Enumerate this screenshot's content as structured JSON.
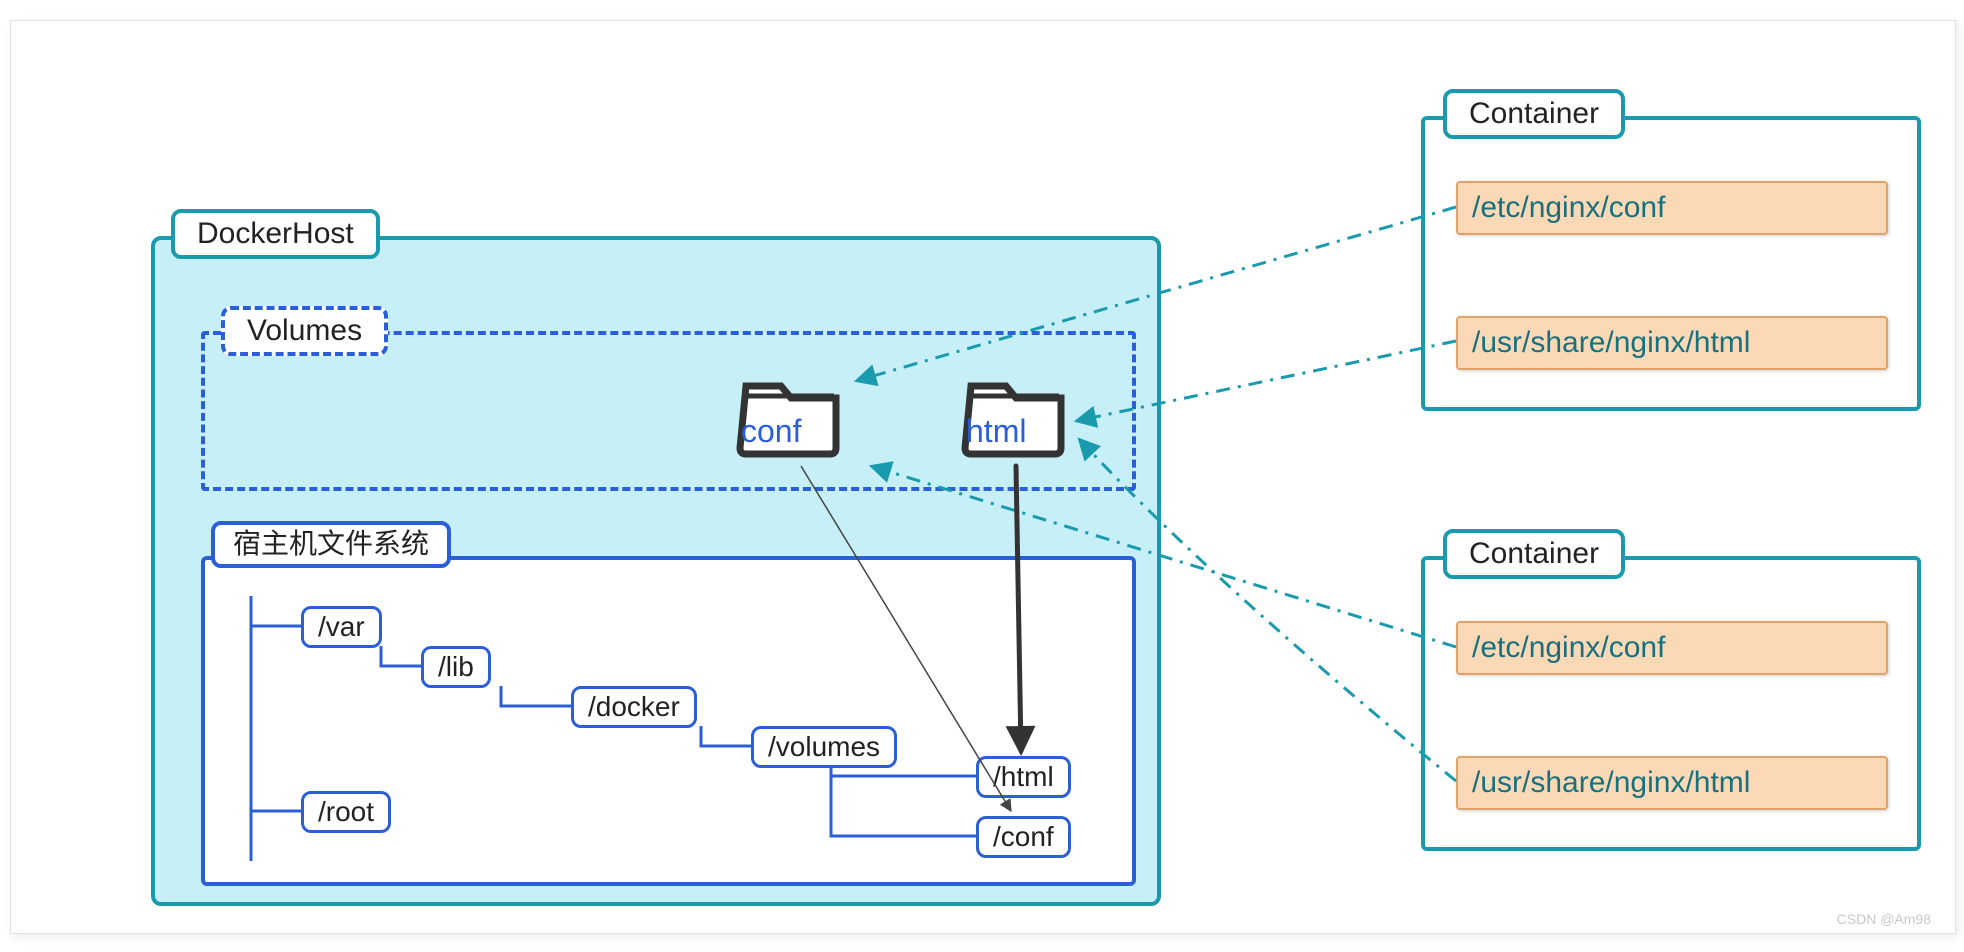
{
  "watermark": "CSDN @Am98",
  "dockerHost": {
    "title": "DockerHost"
  },
  "volumes": {
    "title": "Volumes",
    "folders": {
      "conf": "conf",
      "html": "html"
    }
  },
  "hostFs": {
    "title": "宿主机文件系统",
    "var": "/var",
    "lib": "/lib",
    "docker": "/docker",
    "volumes": "/volumes",
    "html": "/html",
    "conf": "/conf",
    "root": "/root"
  },
  "container1": {
    "title": "Container",
    "conf": "/etc/nginx/conf",
    "html": "/usr/share/nginx/html"
  },
  "container2": {
    "title": "Container",
    "conf": "/etc/nginx/conf",
    "html": "/usr/share/nginx/html"
  }
}
